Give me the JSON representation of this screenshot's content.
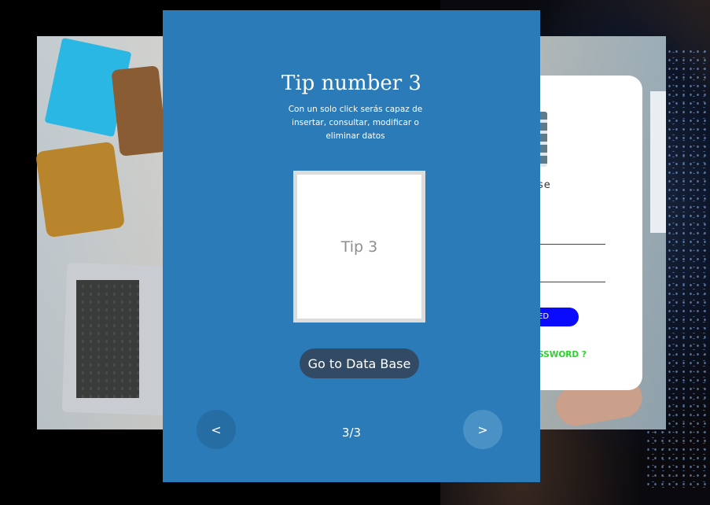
{
  "modal": {
    "title": "Tip number 3",
    "description": "Con un solo click serás capaz de insertar, consultar, modificar o eliminar datos",
    "image_placeholder": "Tip 3",
    "go_button": "Go to Data Base",
    "prev_label": "<",
    "next_label": ">",
    "pager": "3/3"
  },
  "login": {
    "title_fragment": "se",
    "button_fragment": "TED",
    "forgot_fragment": "ASSWORD ?"
  },
  "colors": {
    "modal_bg": "#2a7bb7",
    "go_button_bg": "#334a64",
    "login_button_bg": "#0a0aff",
    "forgot_link": "#2ad32a"
  }
}
